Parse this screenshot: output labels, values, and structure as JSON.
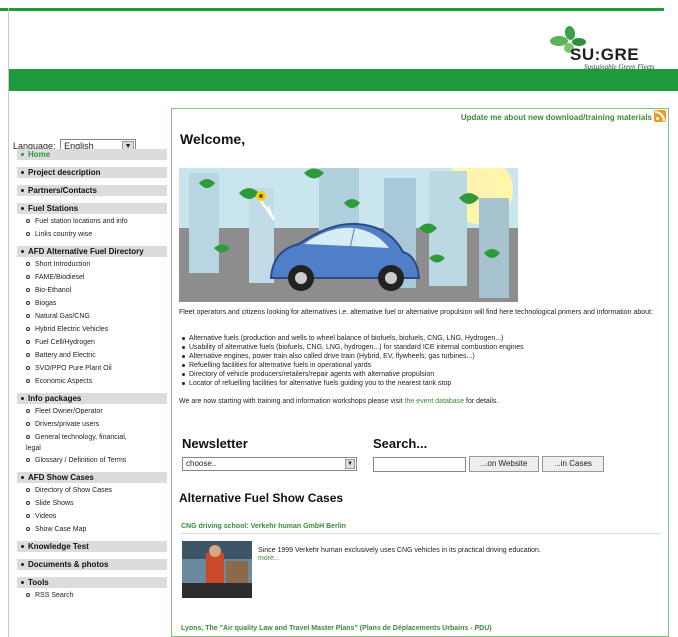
{
  "brand": {
    "logo_text": "SU:GRE",
    "tagline": "Sustainable Green Fleets"
  },
  "colors": {
    "brand_green": "#1e9a3c",
    "link_green": "#3c8a3c",
    "rss_orange": "#f39a1e"
  },
  "sidebar": {
    "language_label": "Language:",
    "language_value": "English",
    "sections": [
      {
        "label": "Home",
        "active": true,
        "subs": []
      },
      {
        "label": "Project description",
        "subs": []
      },
      {
        "label": "Partners/Contacts",
        "subs": []
      },
      {
        "label": "Fuel Stations",
        "subs": [
          "Fuel station locations and info",
          "Links country wise"
        ]
      },
      {
        "label": "AFD Alternative Fuel Directory",
        "subs": [
          "Short Introduction",
          "FAME/Biodiesel",
          "Bio-Ethanol",
          "Biogas",
          "Natural Gas/CNG",
          "Hybrid Electric Vehicles",
          "Fuel Cell/Hydrogen",
          "Battery and Electric",
          "SVO/PPO Pure Plant Oil",
          "Economic Aspects"
        ]
      },
      {
        "label": "Info packages",
        "subs": [
          "Fleet Owner/Operator",
          "Drivers/private users",
          "General technology, financial,",
          "legal",
          "Glossary / Definition of Terms"
        ]
      },
      {
        "label": "AFD Show Cases",
        "subs": [
          "Directory of Show Cases",
          "Slide Shows",
          "Videos",
          "Show Case Map"
        ]
      },
      {
        "label": "Knowledge Test",
        "subs": []
      },
      {
        "label": "Documents & photos",
        "subs": []
      },
      {
        "label": "Tools",
        "subs": [
          "RSS Search"
        ]
      }
    ]
  },
  "main": {
    "update_link": "Update me about new download/training materials",
    "welcome": "Welcome,",
    "intro": "Fleet operators and citizens looking for alternatives i.e. alternative fuel or alternative propulsion will find here technological primers and information about:",
    "bullets": [
      "Alternative fuels (production and wells to wheel balance of biofuels, biofuels, CNG, LNG, Hydrogen...)",
      "Usability of alternative fuels (biofuels, CNG, LNG, hydrogen...) for standard ICE internal combustion engines",
      "Alternative engines, power train also called drive train (Hybrid, EV, flywheels, gas turbines...)",
      "Refuelling facilities for alternative fuels in operational yards",
      "Directory of vehicle producers/retailers/repair agents with alternative propulsion",
      "Locator of refuelling facilities for alternative fuels guiding you to the nearest tank stop"
    ],
    "after_pre": "We are now starting with training and information workshops please visit ",
    "after_link": "the event database",
    "after_post": " for details.",
    "newsletter_title": "Newsletter",
    "newsletter_select": "choose..",
    "search_title": "Search...",
    "search_website_btn": "...on Website",
    "search_cases_btn": "...in Cases",
    "show_cases_title": "Alternative Fuel Show Cases",
    "case1_title": "CNG driving school: Verkehr human GmbH Berlin",
    "case1_text": "Since 1999 Verkehr human exclusively uses CNG vehicles in its practical driving education.",
    "case1_more": "more...",
    "case2_title": "Lyons, The \"Air quality Law and Travel Master Plans\" (Plans de Déplacements Urbains - PDU)"
  }
}
